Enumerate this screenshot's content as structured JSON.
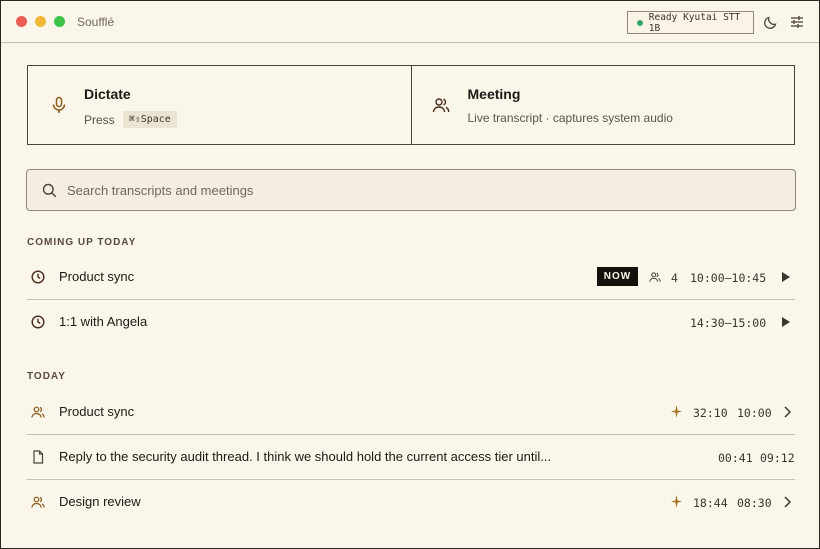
{
  "app": {
    "title": "Soufflé",
    "status": "Ready Kyutai STT 1B",
    "colors": {
      "accent": "#8a5a1c",
      "status_ok": "#2fa866",
      "background": "#fbf6ea"
    }
  },
  "titlebar_icons": [
    "moon-icon",
    "sliders-icon"
  ],
  "actions": [
    {
      "title": "Dictate",
      "subtitle": "Press",
      "shortcut": "⌘⇧Space",
      "icon": "microphone-icon"
    },
    {
      "title": "Meeting",
      "subtitle": "Live transcript · captures system audio",
      "icon": "people-icon"
    }
  ],
  "search": {
    "placeholder": "Search transcripts and meetings",
    "value": ""
  },
  "upcoming": {
    "heading": "COMING UP TODAY",
    "items": [
      {
        "title": "Product sync",
        "badge": "NOW",
        "attendees": "4",
        "time": "10:00–10:45",
        "icon": "clock-icon"
      },
      {
        "title": "1:1 with Angela",
        "time": "14:30–15:00",
        "icon": "clock-icon"
      }
    ]
  },
  "today": {
    "heading": "TODAY",
    "items": [
      {
        "title": "Product sync",
        "duration": "32:10",
        "time": "10:00",
        "icon": "people-icon",
        "starred": true
      },
      {
        "title": "Reply to the security audit thread. I think we should hold the current access tier until...",
        "duration": "00:41",
        "time": "09:12",
        "icon": "document-icon",
        "starred": false
      },
      {
        "title": "Design review",
        "duration": "18:44",
        "time": "08:30",
        "icon": "people-icon",
        "starred": true
      }
    ]
  }
}
